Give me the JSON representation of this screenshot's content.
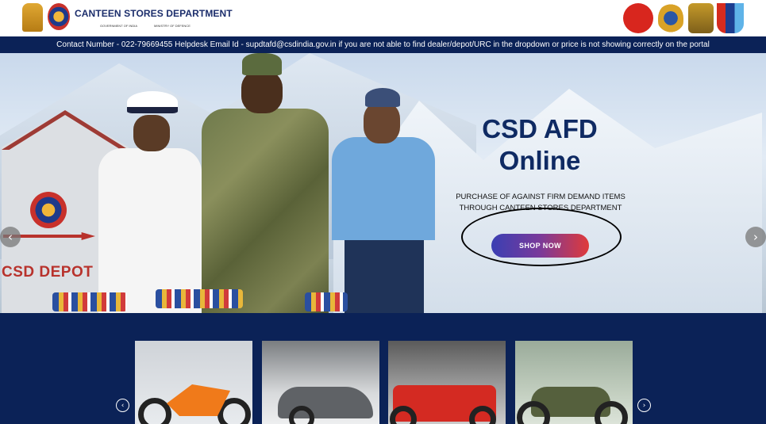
{
  "header": {
    "title": "CANTEEN STORES DEPARTMENT",
    "subtitle_left": "GOVERNMENT OF INDIA",
    "subtitle_right": "MINISTRY OF DEFENCE"
  },
  "info_bar": {
    "text": "Contact Number - 022-79669455 Helpdesk Email Id - supdtafd@csdindia.gov.in if you are not able to find dealer/depot/URC in the dropdown or price is not showing correctly on the portal"
  },
  "hero": {
    "title_line1": "CSD AFD",
    "title_line2": "Online",
    "subtitle": "PURCHASE OF AGAINST FIRM DEMAND ITEMS THROUGH CANTEEN STORES DEPARTMENT",
    "shop_button": "SHOP NOW",
    "depot_sign": "CSD DEPOT",
    "prev_icon": "‹",
    "next_icon": "›"
  },
  "products": {
    "items": [
      {
        "name": "motorcycle-orange"
      },
      {
        "name": "car-silver"
      },
      {
        "name": "jeep-red"
      },
      {
        "name": "motorcycle-green"
      }
    ],
    "prev_icon": "‹",
    "next_icon": "›"
  },
  "colors": {
    "navy": "#0b2257",
    "brand_text": "#1b2d6b",
    "button_start": "#3a3fb3",
    "button_end": "#e03a3a"
  }
}
